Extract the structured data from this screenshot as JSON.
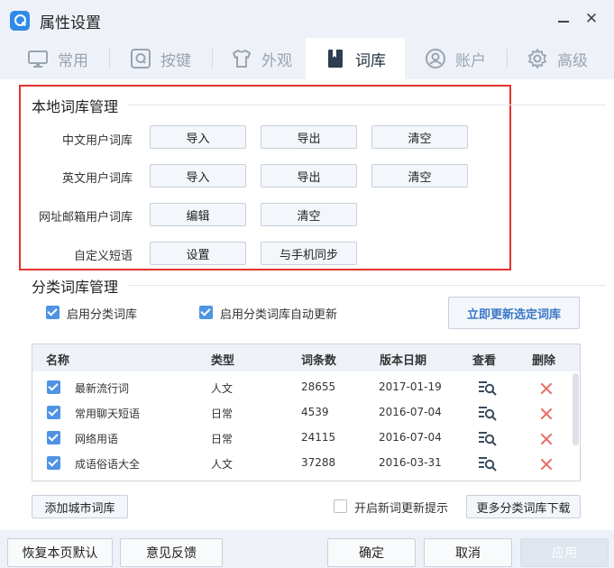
{
  "window": {
    "title": "属性设置",
    "close_glyph": "✕"
  },
  "tabs": [
    {
      "label": "常用",
      "icon": "monitor-icon",
      "active": false
    },
    {
      "label": "按键",
      "icon": "key-q-icon",
      "active": false
    },
    {
      "label": "外观",
      "icon": "shirt-icon",
      "active": false
    },
    {
      "label": "词库",
      "icon": "book-icon",
      "active": true
    },
    {
      "label": "账户",
      "icon": "user-icon",
      "active": false
    },
    {
      "label": "高级",
      "icon": "gear-icon",
      "active": false
    }
  ],
  "local": {
    "title": "本地词库管理",
    "rows": [
      {
        "label": "中文用户词库",
        "buttons": [
          "导入",
          "导出",
          "清空"
        ]
      },
      {
        "label": "英文用户词库",
        "buttons": [
          "导入",
          "导出",
          "清空"
        ]
      },
      {
        "label": "网址邮箱用户词库",
        "buttons": [
          "编辑",
          "清空"
        ]
      },
      {
        "label": "自定义短语",
        "buttons": [
          "设置",
          "与手机同步"
        ]
      }
    ]
  },
  "category": {
    "title": "分类词库管理",
    "enable_label": "启用分类词库",
    "enable_checked": true,
    "auto_update_label": "启用分类词库自动更新",
    "auto_update_checked": true,
    "update_now_label": "立即更新选定词库",
    "columns": [
      "名称",
      "类型",
      "词条数",
      "版本日期",
      "查看",
      "删除"
    ],
    "rows": [
      {
        "checked": true,
        "name": "最新流行词",
        "type": "人文",
        "count": "28655",
        "date": "2017-01-19"
      },
      {
        "checked": true,
        "name": "常用聊天短语",
        "type": "日常",
        "count": "4539",
        "date": "2016-07-04"
      },
      {
        "checked": true,
        "name": "网络用语",
        "type": "日常",
        "count": "24115",
        "date": "2016-07-04"
      },
      {
        "checked": true,
        "name": "成语俗语大全",
        "type": "人文",
        "count": "37288",
        "date": "2016-03-31"
      }
    ],
    "add_city_label": "添加城市词库",
    "new_word_tip_label": "开启新词更新提示",
    "new_word_tip_checked": false,
    "more_download_label": "更多分类词库下载"
  },
  "footer": {
    "restore_label": "恢复本页默认",
    "feedback_label": "意见反馈",
    "ok_label": "确定",
    "cancel_label": "取消",
    "apply_label": "应用"
  },
  "colors": {
    "accent": "#2f8ae8",
    "checkbox": "#4f93e4",
    "highlight_box": "#e8322d",
    "delete": "#e86a66",
    "primary_text": "#3b77c6"
  }
}
